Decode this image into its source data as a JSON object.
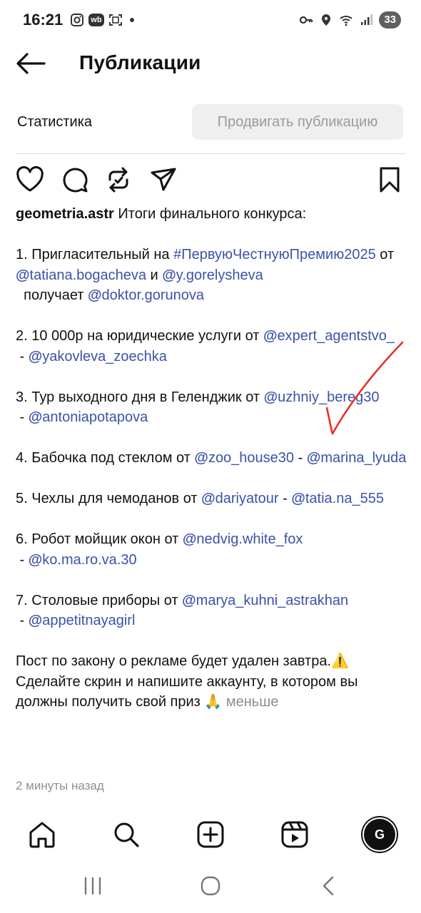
{
  "status_bar": {
    "time": "16:21",
    "wb_label": "wb",
    "battery": "33"
  },
  "header": {
    "title": "Публикации"
  },
  "stats": {
    "link_label": "Статистика",
    "promote_label": "Продвигать публикацию"
  },
  "caption": {
    "username": "geometria.astr",
    "intro": " Итоги финального конкурса:",
    "items": [
      {
        "prefix": "1. Пригласительный на ",
        "hashtag": "#ПервуюЧестнуюПремию2025",
        "mid1": " от ",
        "m1": "tatiana.bogacheva",
        "mid2": " и ",
        "m2": "y.gorelysheva",
        "mid3": "  получает ",
        "m3": "doktor.gorunova"
      },
      {
        "prefix": "2. 10 000р на юридические услуги от ",
        "m1": "expert_agentstvo_",
        "sep": " - ",
        "m2": "yakovleva_zoechka"
      },
      {
        "prefix": "3. Тур выходного дня в Геленджик от ",
        "m1": "uzhniy_bereg30",
        "sep": " - ",
        "m2": "antoniapotapova"
      },
      {
        "prefix": "4. Бабочка под стеклом от ",
        "m1": "zoo_house30",
        "sep": " - ",
        "m2": "marina_lyuda"
      },
      {
        "prefix": "5. Чехлы для чемоданов от ",
        "m1": "dariyatour",
        "sep": " - ",
        "m2": "tatia.na_555"
      },
      {
        "prefix": "6. Робот мойщик окон от ",
        "m1": "nedvig.white_fox",
        "sep": " - ",
        "m2": "ko.ma.ro.va.30"
      },
      {
        "prefix": "7. Столовые приборы от ",
        "m1": "marya_kuhni_astrakhan",
        "sep": " - ",
        "m2": "appetitnayagirl"
      }
    ],
    "footer_text": "Пост по закону о рекламе будет удален завтра.⚠️ Сделайте скрин и напишите аккаунту, в котором вы должны получить свой приз 🙏 ",
    "less_label": "меньше",
    "time_ago": "2 минуты назад"
  },
  "profile": {
    "avatar_text": "G"
  },
  "colors": {
    "mention": "#3b52a8",
    "muted": "#8e8e8e",
    "check": "#e8312b"
  },
  "icons": [
    "heart-icon",
    "comment-icon",
    "repost-icon",
    "share-icon",
    "bookmark-icon",
    "home-icon",
    "search-icon",
    "create-icon",
    "reels-icon"
  ]
}
